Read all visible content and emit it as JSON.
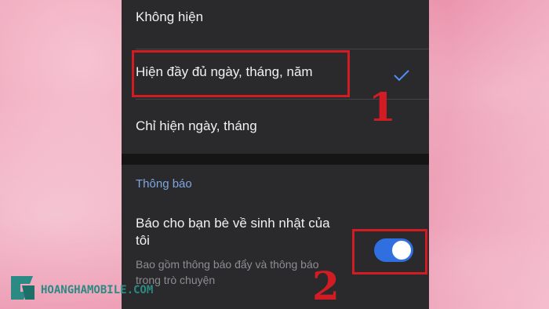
{
  "date_options": [
    {
      "label": "Không hiện",
      "selected": false
    },
    {
      "label": "Hiện đầy đủ ngày, tháng, năm",
      "selected": true
    },
    {
      "label": "Chỉ hiện ngày, tháng",
      "selected": false
    }
  ],
  "notifications": {
    "section_title": "Thông báo",
    "title": "Báo cho bạn bè về sinh nhật của tôi",
    "subtitle": "Bao gồm thông báo đẩy và thông báo trong trò chuyện",
    "toggle_on": true
  },
  "annotations": {
    "step1": "1",
    "step2": "2"
  },
  "watermark": {
    "text": "HOANGHAMOBILE.COM"
  },
  "colors": {
    "highlight": "#d11c24",
    "toggle_on": "#2f6fe0",
    "section_title": "#7ea6e0",
    "check": "#4f8ff7"
  },
  "icons": {
    "check": "check-icon",
    "logo": "hoangha-logo-icon"
  }
}
